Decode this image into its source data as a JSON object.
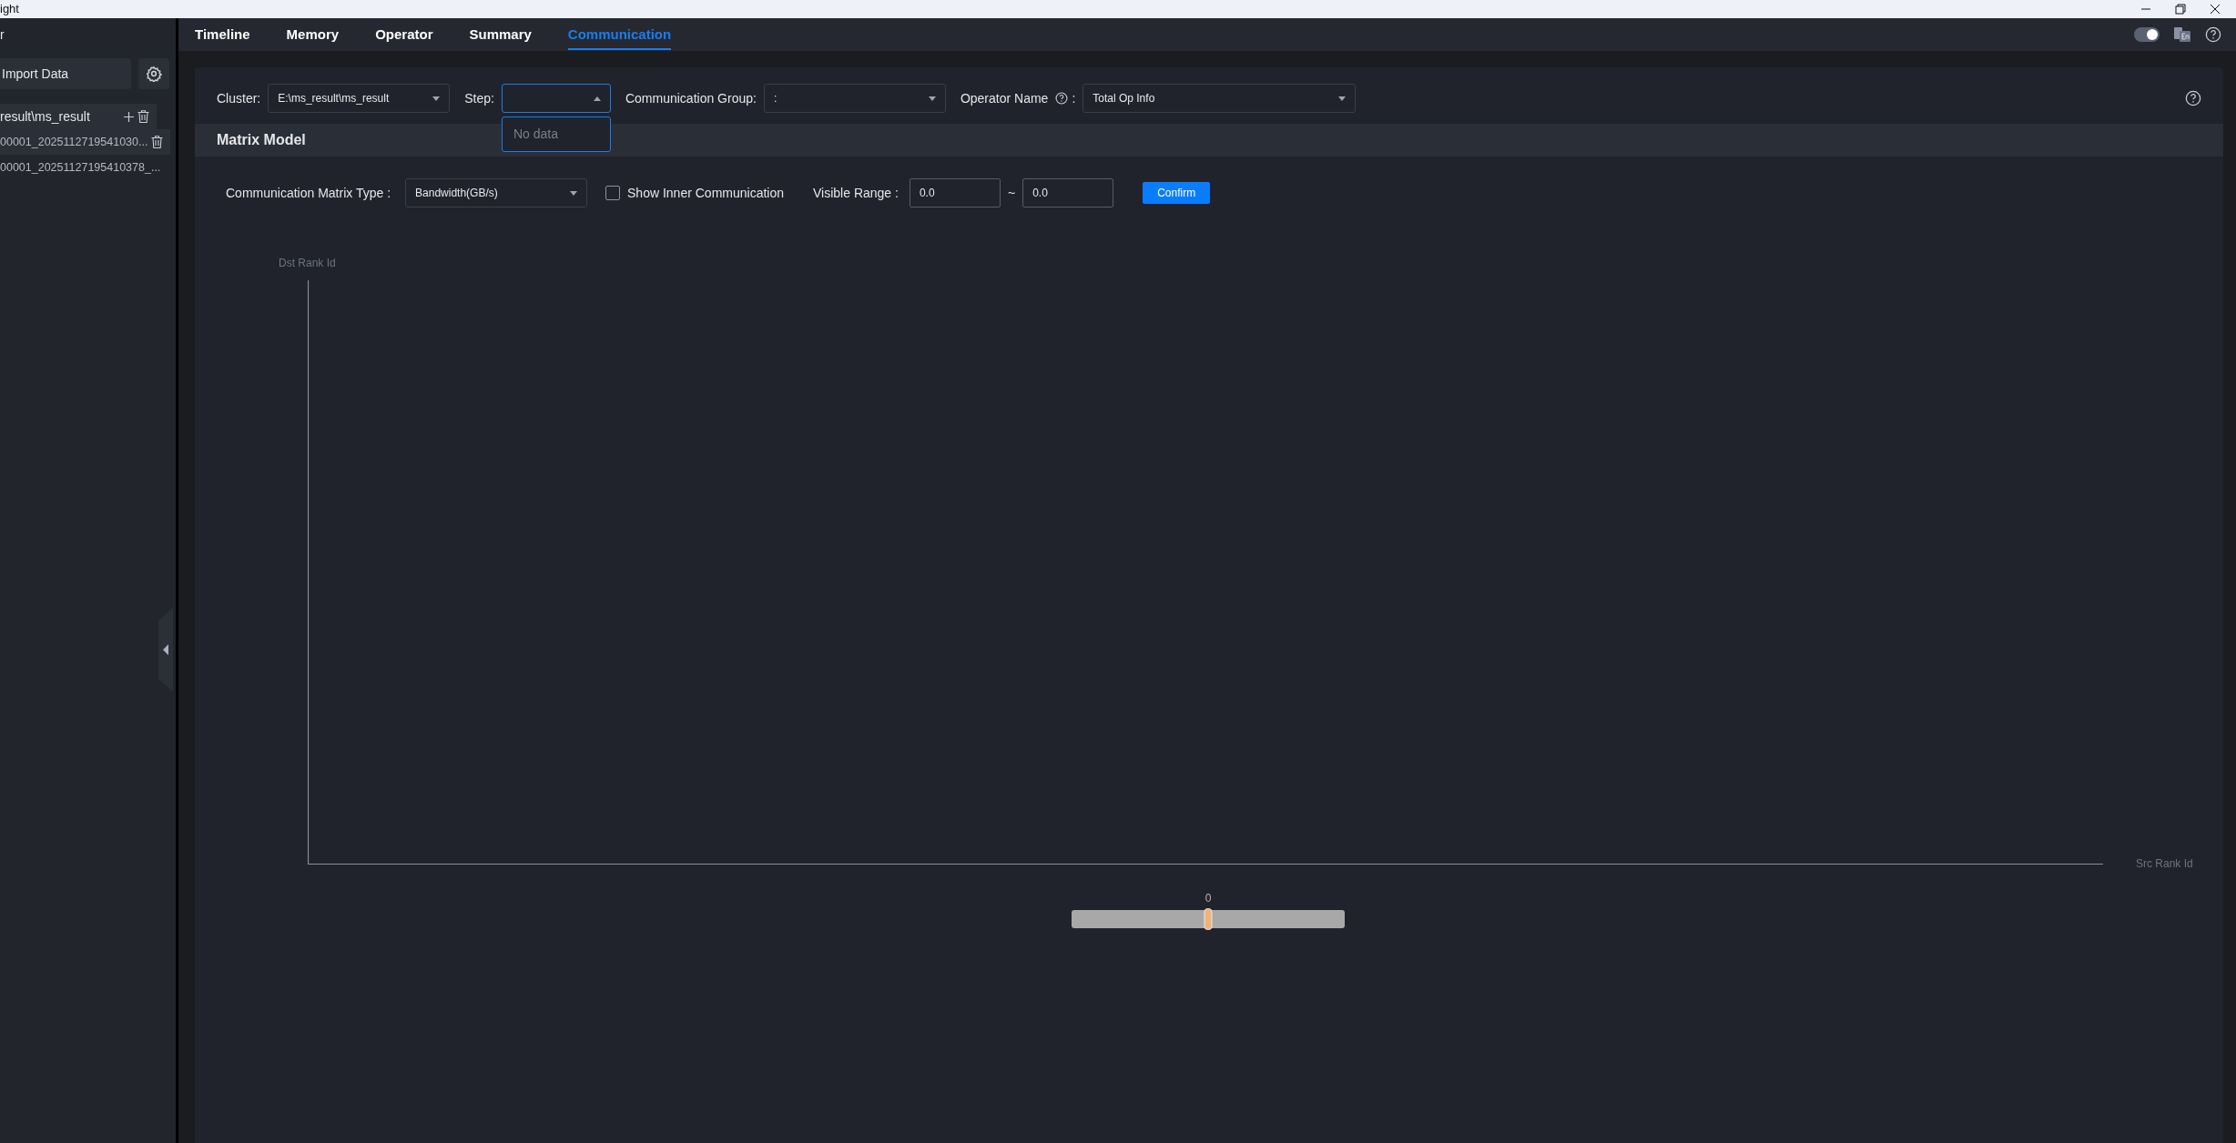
{
  "window": {
    "title": "ight"
  },
  "sidebar": {
    "header": "r",
    "import_button": "Import Data",
    "tree": [
      {
        "label": "result\\ms_result",
        "children": [
          {
            "label": "00001_2025112719541030..."
          },
          {
            "label": "00001_20251127195410378_..."
          }
        ]
      }
    ]
  },
  "tabs": [
    {
      "label": "Timeline",
      "selected": false
    },
    {
      "label": "Memory",
      "selected": false
    },
    {
      "label": "Operator",
      "selected": false
    },
    {
      "label": "Summary",
      "selected": false
    },
    {
      "label": "Communication",
      "selected": true
    }
  ],
  "theme_toggle": {
    "on": true
  },
  "filters": [
    {
      "label": "Cluster:",
      "value": "E:\\ms_result\\ms_result",
      "open": false
    },
    {
      "label": "Step:",
      "open": true,
      "dropdown_message": "No data"
    },
    {
      "label": "Communication Group:",
      "value": ":",
      "open": false
    },
    {
      "label": "Operator Name",
      "help_suffix": ":",
      "value": "Total Op Info",
      "open": false
    }
  ],
  "matrix": {
    "title": "Matrix Model",
    "type_label": "Communication Matrix Type :",
    "type_value": "Bandwidth(GB/s)",
    "inner_label": "Show Inner Communication",
    "inner_checked": false,
    "range_label": "Visible Range :",
    "range_min": "0.0",
    "range_sep": "~",
    "range_max": "0.0",
    "confirm": "Confirm",
    "y_axis_label": "Dst Rank Id",
    "x_axis_label": "Src Rank Id",
    "slider": {
      "reading": "0",
      "level": 0.5
    }
  }
}
